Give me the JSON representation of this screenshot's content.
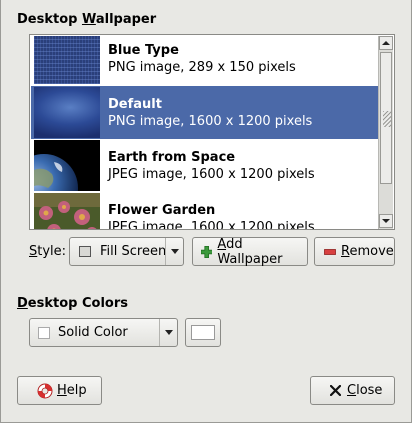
{
  "wallpaper_section": {
    "title_pre": "Desktop ",
    "title_mnemonic": "W",
    "title_post": "allpaper"
  },
  "wallpapers": [
    {
      "name": "Blue Type",
      "desc": "PNG image, 289 x 150 pixels",
      "thumb": "blue-type-thumbnail"
    },
    {
      "name": "Default",
      "desc": "PNG image, 1600 x 1200 pixels",
      "thumb": "default-thumbnail"
    },
    {
      "name": "Earth from Space",
      "desc": "JPEG image, 1600 x 1200 pixels",
      "thumb": "earth-thumbnail"
    },
    {
      "name": "Flower Garden",
      "desc": "JPEG image, 1600 x 1200 pixels",
      "thumb": "flower-garden-thumbnail"
    }
  ],
  "selected_index": 1,
  "style_row": {
    "label_mnemonic": "S",
    "label_rest": "tyle:",
    "style_value": "Fill Screen",
    "add_mnemonic": "A",
    "add_rest": "dd Wallpaper",
    "remove_mnemonic": "R",
    "remove_rest": "emove"
  },
  "colors_section": {
    "title_pre": "",
    "title_mnemonic": "D",
    "title_post": "esktop Colors",
    "color_mode": "Solid Color",
    "color_swatch": "#ffffff"
  },
  "footer": {
    "help_mnemonic": "H",
    "help_rest": "elp",
    "close_mnemonic": "C",
    "close_rest": "lose"
  },
  "colors": {
    "selection": "#4b69a8",
    "window_bg": "#e8e8e4"
  }
}
